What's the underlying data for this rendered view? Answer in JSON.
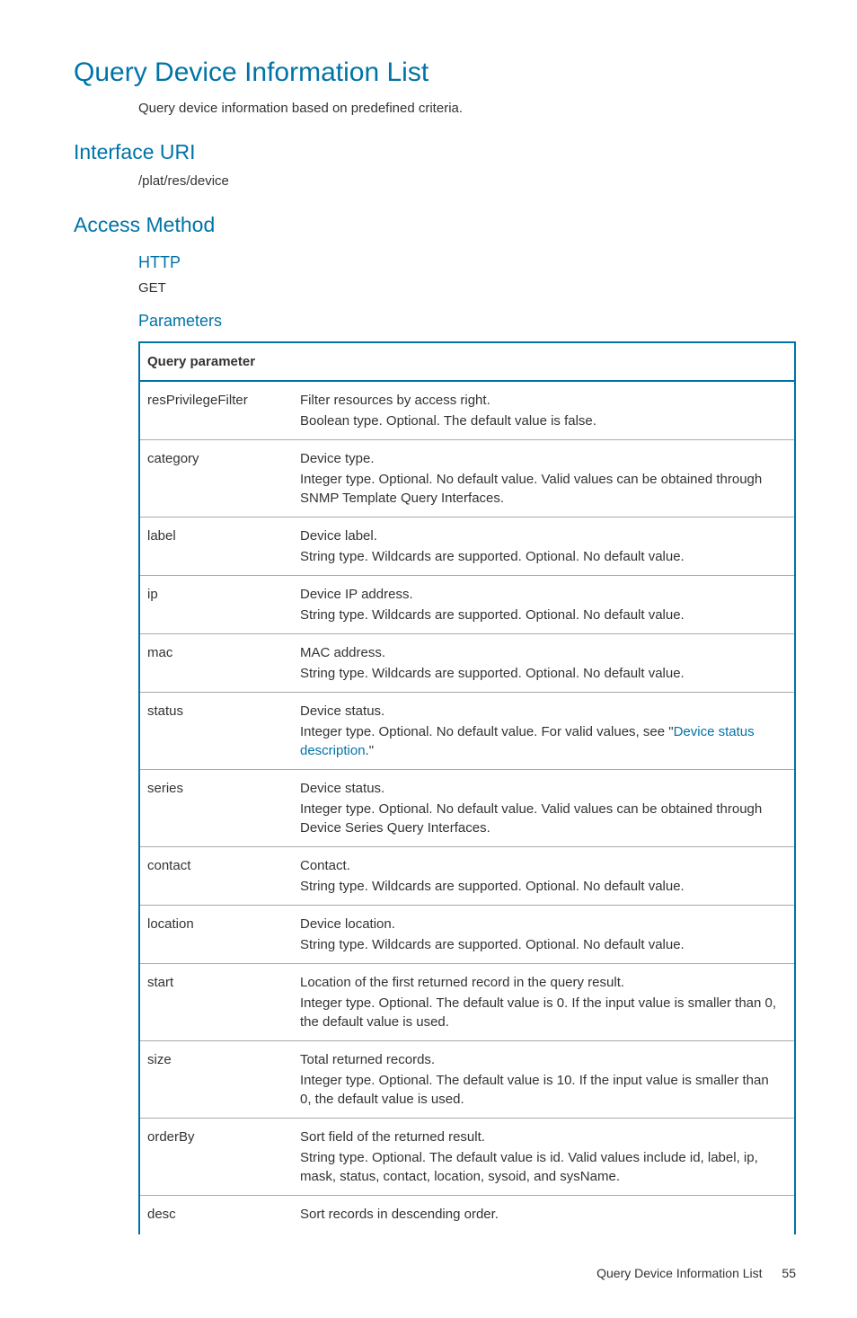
{
  "headings": {
    "title": "Query Device Information List",
    "description": "Query device information based on predefined criteria.",
    "interface_uri_h": "Interface URI",
    "interface_uri": "/plat/res/device",
    "access_method_h": "Access Method",
    "http_h": "HTTP",
    "http_method": "GET",
    "parameters_h": "Parameters"
  },
  "table": {
    "header": "Query parameter",
    "rows": [
      {
        "param": "resPrivilegeFilter",
        "main": "Filter resources by access right.",
        "detail": "Boolean type. Optional. The default value is false."
      },
      {
        "param": "category",
        "main": "Device type.",
        "detail": "Integer type. Optional. No default value. Valid values can be obtained through SNMP Template Query Interfaces."
      },
      {
        "param": "label",
        "main": "Device label.",
        "detail": "String type. Wildcards are supported. Optional. No default value."
      },
      {
        "param": "ip",
        "main": "Device IP address.",
        "detail": "String type. Wildcards are supported. Optional. No default value."
      },
      {
        "param": "mac",
        "main": "MAC address.",
        "detail": "String type. Wildcards are supported. Optional. No default value."
      },
      {
        "param": "status",
        "main": "Device status.",
        "detail_pre": "Integer type. Optional. No default value. For valid values, see \"",
        "link": "Device status description",
        "detail_post": ".\""
      },
      {
        "param": "series",
        "main": "Device status.",
        "detail": "Integer type. Optional. No default value. Valid values can be obtained through Device Series Query Interfaces."
      },
      {
        "param": "contact",
        "main": "Contact.",
        "detail": "String type. Wildcards are supported. Optional. No default value."
      },
      {
        "param": "location",
        "main": "Device location.",
        "detail": "String type. Wildcards are supported. Optional. No default value."
      },
      {
        "param": "start",
        "main": "Location of the first returned record in the query result.",
        "detail": "Integer type. Optional. The default value is 0. If the input value is smaller than 0, the default value is used."
      },
      {
        "param": "size",
        "main": "Total returned records.",
        "detail": "Integer type. Optional. The default value is 10. If the input value is smaller than 0, the default value is used."
      },
      {
        "param": "orderBy",
        "main": "Sort field of the returned result.",
        "detail": "String type. Optional. The default value is id. Valid values include id, label, ip, mask, status, contact, location, sysoid, and sysName."
      },
      {
        "param": "desc",
        "main": "Sort records in descending order.",
        "detail": ""
      }
    ]
  },
  "footer": {
    "label": "Query Device Information List",
    "page": "55"
  }
}
